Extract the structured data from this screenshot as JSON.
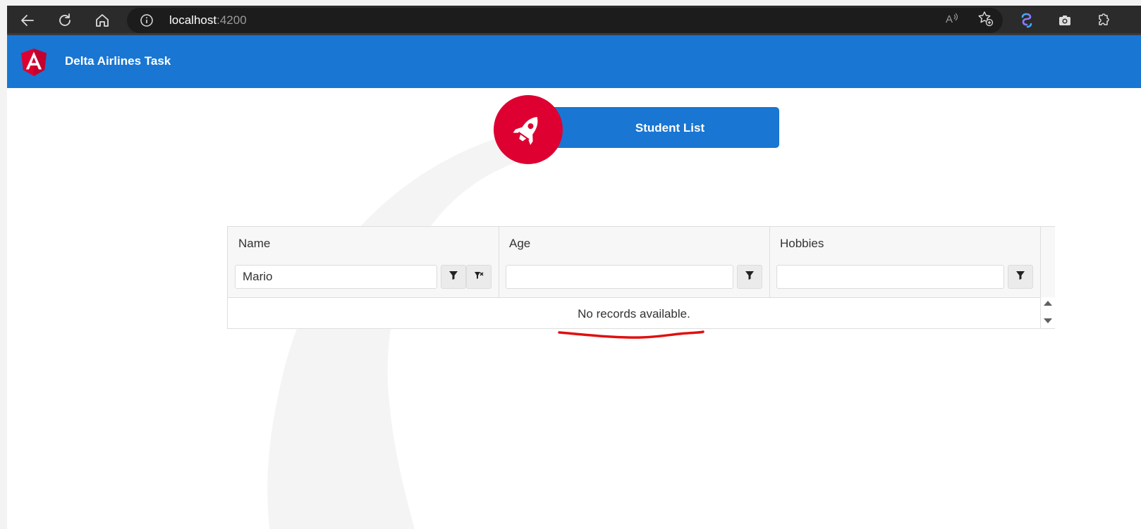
{
  "browser": {
    "url_host": "localhost",
    "url_port": ":4200"
  },
  "app": {
    "title": "Delta Airlines Task",
    "logo_letter": "A"
  },
  "card": {
    "label": "Student List"
  },
  "grid": {
    "columns": [
      "Name",
      "Age",
      "Hobbies"
    ],
    "filters": {
      "name": "Mario",
      "age": "",
      "hobbies": ""
    },
    "empty_message": "No records available."
  },
  "colors": {
    "toolbar": "#1976d2",
    "angular_red": "#dd0031",
    "annotation_red": "#e01010"
  },
  "icons": [
    "back-arrow-icon",
    "refresh-icon",
    "home-icon",
    "info-icon",
    "read-aloud-icon",
    "favorite-add-icon",
    "copilot-icon",
    "screenshot-icon",
    "extensions-icon",
    "angular-logo-icon",
    "rocket-icon",
    "filter-icon",
    "clear-filter-icon"
  ]
}
